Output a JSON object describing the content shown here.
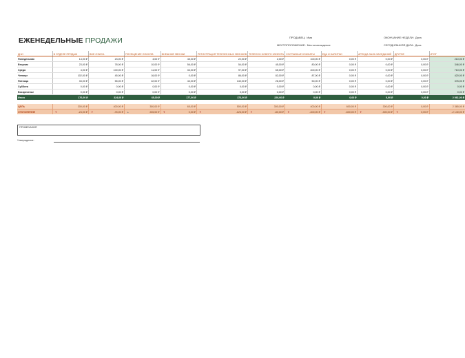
{
  "title": {
    "bold": "ЕЖЕНЕДЕЛЬНЫЕ",
    "rest": "ПРОДАЖИ"
  },
  "meta": {
    "seller_label": "ПРОДАВЕЦ:",
    "seller_value": "Имя",
    "location_label": "МЕСТОПОЛОЖЕНИЕ:",
    "location_value": "Местонахождение",
    "week_end_label": "ОКОНЧАНИЕ НЕДЕЛИ:",
    "week_end_value": "Дата",
    "today_label": "СЕГОДНЯШНЯЯ ДАТА:",
    "today_value": "Дата"
  },
  "headers": [
    "ДНИ",
    "В ОТДЕЛЕ ПРОДАЖ",
    "ВНЕ ОФИСА",
    "ПОСЕЩЕНИЕ ОФИСОВ",
    "ВНЕШНИЕ ЗВОНКИ",
    "РЕГИСТРАЦИЯ ТЕЛЕФОННЫХ ЗВОНКОВ",
    "ТЕЛЕФОН НОВОГО КЛИЕНТА",
    "СОСТАВНЫЕ КОМНАТЫ",
    "ЕДА И НАПИТКИ",
    "АРЕНДА ЗАЛА ЗАСЕДАНИЙ",
    "ДРУГОЕ",
    "ИТОГ"
  ],
  "rows": [
    {
      "day": "Понедельник",
      "values": [
        "14,00 ₽",
        "23,00 ₽",
        "4,00 ₽",
        "45,00 ₽",
        "22,00 ₽",
        "2,00 ₽",
        "100,00 ₽",
        "0,00 ₽",
        "0,00 ₽",
        "0,00 ₽",
        "210,00 ₽"
      ]
    },
    {
      "day": "Вторник",
      "values": [
        "23,00 ₽",
        "78,00 ₽",
        "10,00 ₽",
        "56,00 ₽",
        "54,00 ₽",
        "45,00 ₽",
        "80,00 ₽",
        "0,00 ₽",
        "0,00 ₽",
        "0,00 ₽",
        "346,00 ₽"
      ]
    },
    {
      "day": "Среда",
      "values": [
        "4,00 ₽",
        "100,00 ₽",
        "11,00 ₽",
        "33,00 ₽",
        "97,00 ₽",
        "65,00 ₽",
        "400,00 ₽",
        "0,00 ₽",
        "0,00 ₽",
        "0,00 ₽",
        "710,00 ₽"
      ]
    },
    {
      "day": "Четверг",
      "values": [
        "102,00 ₽",
        "45,00 ₽",
        "16,00 ₽",
        "0,00 ₽",
        "86,00 ₽",
        "82,00 ₽",
        "87,00 ₽",
        "0,00 ₽",
        "0,00 ₽",
        "0,00 ₽",
        "420,00 ₽"
      ]
    },
    {
      "day": "Пятница",
      "values": [
        "33,00 ₽",
        "55,00 ₽",
        "22,00 ₽",
        "43,00 ₽",
        "140,00 ₽",
        "26,00 ₽",
        "50,00 ₽",
        "0,00 ₽",
        "0,00 ₽",
        "0,00 ₽",
        "376,00 ₽"
      ]
    },
    {
      "day": "Суббота",
      "values": [
        "0,00 ₽",
        "0,00 ₽",
        "0,00 ₽",
        "0,00 ₽",
        "0,00 ₽",
        "0,00 ₽",
        "0,00 ₽",
        "0,00 ₽",
        "0,00 ₽",
        "0,00 ₽",
        "0,00 ₽"
      ]
    },
    {
      "day": "Воскресенье",
      "values": [
        "0,00 ₽",
        "0,00 ₽",
        "0,00 ₽",
        "0,00 ₽",
        "0,00 ₽",
        "0,00 ₽",
        "0,00 ₽",
        "0,00 ₽",
        "0,00 ₽",
        "0,00 ₽",
        "0,00 ₽"
      ]
    }
  ],
  "totals": {
    "label": "Итого",
    "values": [
      "176,00 ₽",
      "324,00 ₽",
      "65,00 ₽",
      "177,00 ₽",
      "373,00 ₽",
      "220,00 ₽",
      "0,00 ₽",
      "0,00 ₽",
      "0,00 ₽",
      "0,00 ₽",
      "2 061,00 ₽"
    ]
  },
  "goal": {
    "label": "ЦЕЛЬ",
    "values": [
      "200,00 ₽",
      "400,00 ₽",
      "300,00 ₽",
      "65,00 ₽",
      "500,00 ₽",
      "300,00 ₽",
      "400,00 ₽",
      "600,00 ₽",
      "300,00 ₽",
      "0,00 ₽",
      "2 365,00 ₽"
    ]
  },
  "deviation": {
    "label": "ОТКЛОНЕНИЕ",
    "values": [
      "-24,00 ₽",
      "-76,00 ₽",
      "235,00 ₽",
      "0,00 ₽",
      "-126,00 ₽",
      "-80,00 ₽",
      "-400,00 ₽",
      "-600,00 ₽",
      "-300,00 ₽",
      "0,00 ₽",
      "-2 140,00 ₽"
    ],
    "arrows": [
      "down",
      "down",
      "up",
      "down",
      "down",
      "down",
      "down",
      "down",
      "down",
      "down",
      ""
    ]
  },
  "notes_label": "ПРИМЕЧАНИЯ",
  "approval_label": "Утверждение:",
  "colors": {
    "accent_orange": "#c0571a",
    "total_green": "#2f5e3f",
    "goal_peach": "#f7d6bd",
    "total_col": "#d6e9dc"
  }
}
